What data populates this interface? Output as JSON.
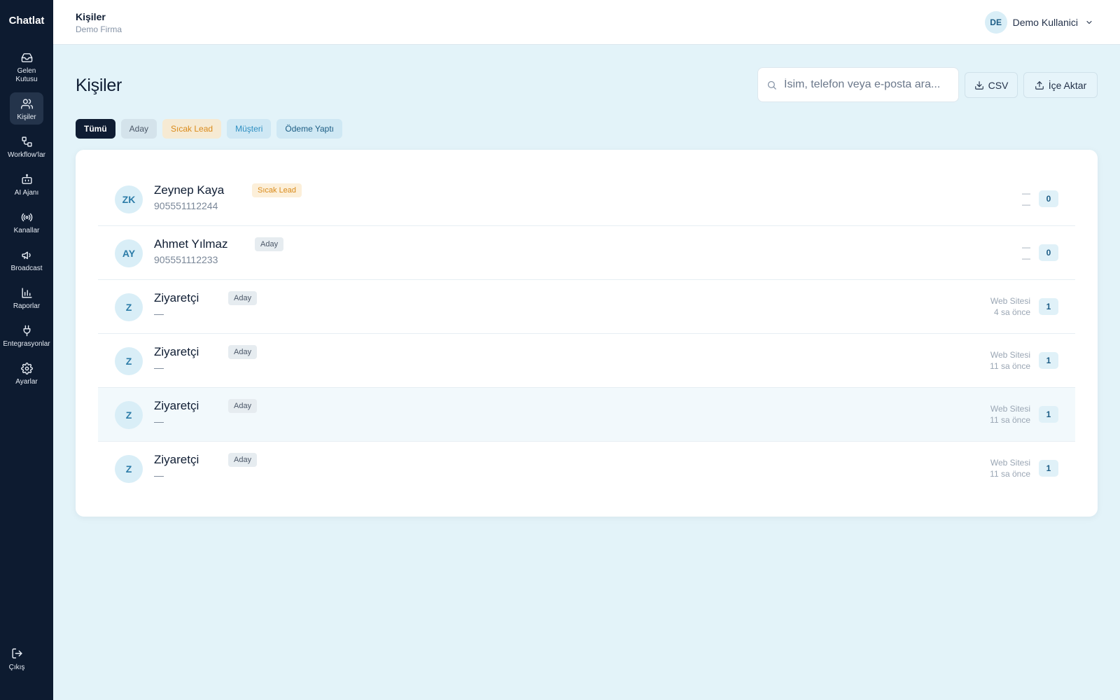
{
  "app": {
    "name": "Chatlat"
  },
  "sidebar": {
    "items": [
      {
        "label": "Gelen Kutusu",
        "icon": "inbox-icon",
        "active": false
      },
      {
        "label": "Kişiler",
        "icon": "users-icon",
        "active": true
      },
      {
        "label": "Workflow'lar",
        "icon": "workflow-icon",
        "active": false
      },
      {
        "label": "AI Ajanı",
        "icon": "bot-icon",
        "active": false
      },
      {
        "label": "Kanallar",
        "icon": "broadcast-signal-icon",
        "active": false
      },
      {
        "label": "Broadcast",
        "icon": "megaphone-icon",
        "active": false
      },
      {
        "label": "Raporlar",
        "icon": "bar-chart-icon",
        "active": false
      },
      {
        "label": "Entegrasyonlar",
        "icon": "plug-icon",
        "active": false
      },
      {
        "label": "Ayarlar",
        "icon": "gear-icon",
        "active": false
      }
    ],
    "logout_label": "Çıkış"
  },
  "topbar": {
    "title": "Kişiler",
    "subtitle": "Demo Firma",
    "user_initials": "DE",
    "user_name": "Demo Kullanici"
  },
  "main": {
    "title": "Kişiler",
    "search_placeholder": "İsim, telefon veya e-posta ara...",
    "csv_label": "CSV",
    "import_label": "İçe Aktar",
    "filters": [
      "Tümü",
      "Aday",
      "Sıcak Lead",
      "Müşteri",
      "Ödeme Yaptı"
    ]
  },
  "contacts": [
    {
      "initials": "ZK",
      "name": "Zeynep Kaya",
      "tag": "Sıcak Lead",
      "sub": "905551112244",
      "source": "—",
      "time": "—",
      "count": "0"
    },
    {
      "initials": "AY",
      "name": "Ahmet Yılmaz",
      "tag": "Aday",
      "sub": "905551112233",
      "source": "—",
      "time": "—",
      "count": "0"
    },
    {
      "initials": "Z",
      "name": "Ziyaretçi",
      "tag": "Aday",
      "sub": "—",
      "source": "Web Sitesi",
      "time": "4 sa önce",
      "count": "1"
    },
    {
      "initials": "Z",
      "name": "Ziyaretçi",
      "tag": "Aday",
      "sub": "—",
      "source": "Web Sitesi",
      "time": "11 sa önce",
      "count": "1"
    },
    {
      "initials": "Z",
      "name": "Ziyaretçi",
      "tag": "Aday",
      "sub": "—",
      "source": "Web Sitesi",
      "time": "11 sa önce",
      "count": "1"
    },
    {
      "initials": "Z",
      "name": "Ziyaretçi",
      "tag": "Aday",
      "sub": "—",
      "source": "Web Sitesi",
      "time": "11 sa önce",
      "count": "1"
    }
  ],
  "colors": {
    "sidebar": "#0d1b30",
    "background": "#e3f3f9",
    "accent": "#1d5d86",
    "warm": "#d98a1a"
  }
}
